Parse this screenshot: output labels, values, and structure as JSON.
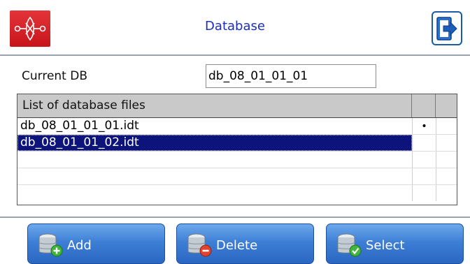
{
  "header": {
    "title": "Database",
    "logo_icon": "ornament-logo-icon",
    "exit_icon": "exit-door-icon",
    "accent": "#1a2fbd",
    "logo_color": "#d61e24"
  },
  "current_db": {
    "label": "Current DB",
    "value": "db_08_01_01_01"
  },
  "file_list": {
    "header": "List of database files",
    "rows": [
      {
        "name": "db_08_01_01_01.idt",
        "mark": "•",
        "selected": false
      },
      {
        "name": "db_08_01_01_02.idt",
        "mark": "",
        "selected": true
      },
      {
        "name": "",
        "mark": "",
        "selected": false
      },
      {
        "name": "",
        "mark": "",
        "selected": false
      },
      {
        "name": "",
        "mark": "",
        "selected": false
      }
    ],
    "selection_color": "#0c137a"
  },
  "actions": {
    "add_label": "Add",
    "delete_label": "Delete",
    "select_label": "Select",
    "add_icon": "database-add-icon",
    "delete_icon": "database-delete-icon",
    "select_icon": "database-check-icon"
  }
}
